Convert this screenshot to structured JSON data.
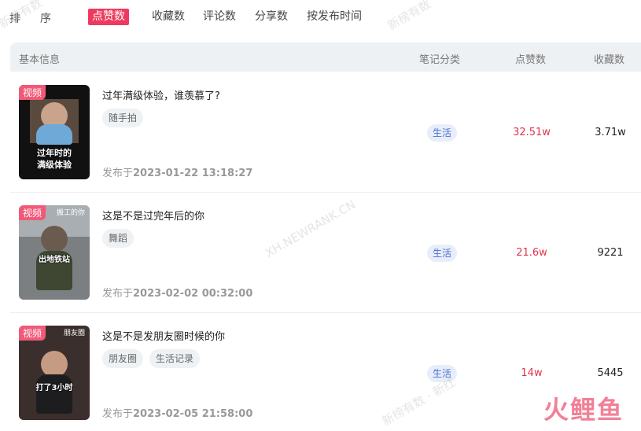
{
  "sort_bar": {
    "label_1": "排",
    "label_2": "序",
    "options": [
      "点赞数",
      "收藏数",
      "评论数",
      "分享数",
      "按发布时间"
    ],
    "active_index": 0
  },
  "table_header": {
    "basic_info": "基本信息",
    "category": "笔记分类",
    "likes": "点赞数",
    "favorites": "收藏数"
  },
  "rows": [
    {
      "badge": "视频",
      "cover_caption_1": "过年时的",
      "cover_caption_2": "满级体验",
      "title": "过年满级体验，谁羡慕了?",
      "tags": [
        "随手拍"
      ],
      "published_prefix": "发布于",
      "published": "2023-01-22 13:18:27",
      "category": "生活",
      "likes": "32.51w",
      "favorites": "3.71w"
    },
    {
      "badge": "视频",
      "cover_top": "搬工的你",
      "cover_caption_1": "出地铁站",
      "title": "这是不是过完年后的你",
      "tags": [
        "舞蹈"
      ],
      "published_prefix": "发布于",
      "published": "2023-02-02 00:32:00",
      "category": "生活",
      "likes": "21.6w",
      "favorites": "9221"
    },
    {
      "badge": "视频",
      "cover_top": "朋友圈",
      "cover_caption_1": "打了3小时",
      "title": "这是不是发朋友圈时候的你",
      "tags": [
        "朋友圈",
        "生活记录"
      ],
      "published_prefix": "发布于",
      "published": "2023-02-05 21:58:00",
      "category": "生活",
      "likes": "14w",
      "favorites": "5445"
    }
  ],
  "watermarks": {
    "cn": "新榜有数",
    "en": "XH.NEWRANK.CN",
    "cn_2": "新榜有数 · 新红"
  },
  "logo": "火鲤鱼",
  "colors": {
    "accent": "#ee3a5e",
    "likes_red": "#e0344c",
    "category_blue": "#4a6fd0"
  }
}
